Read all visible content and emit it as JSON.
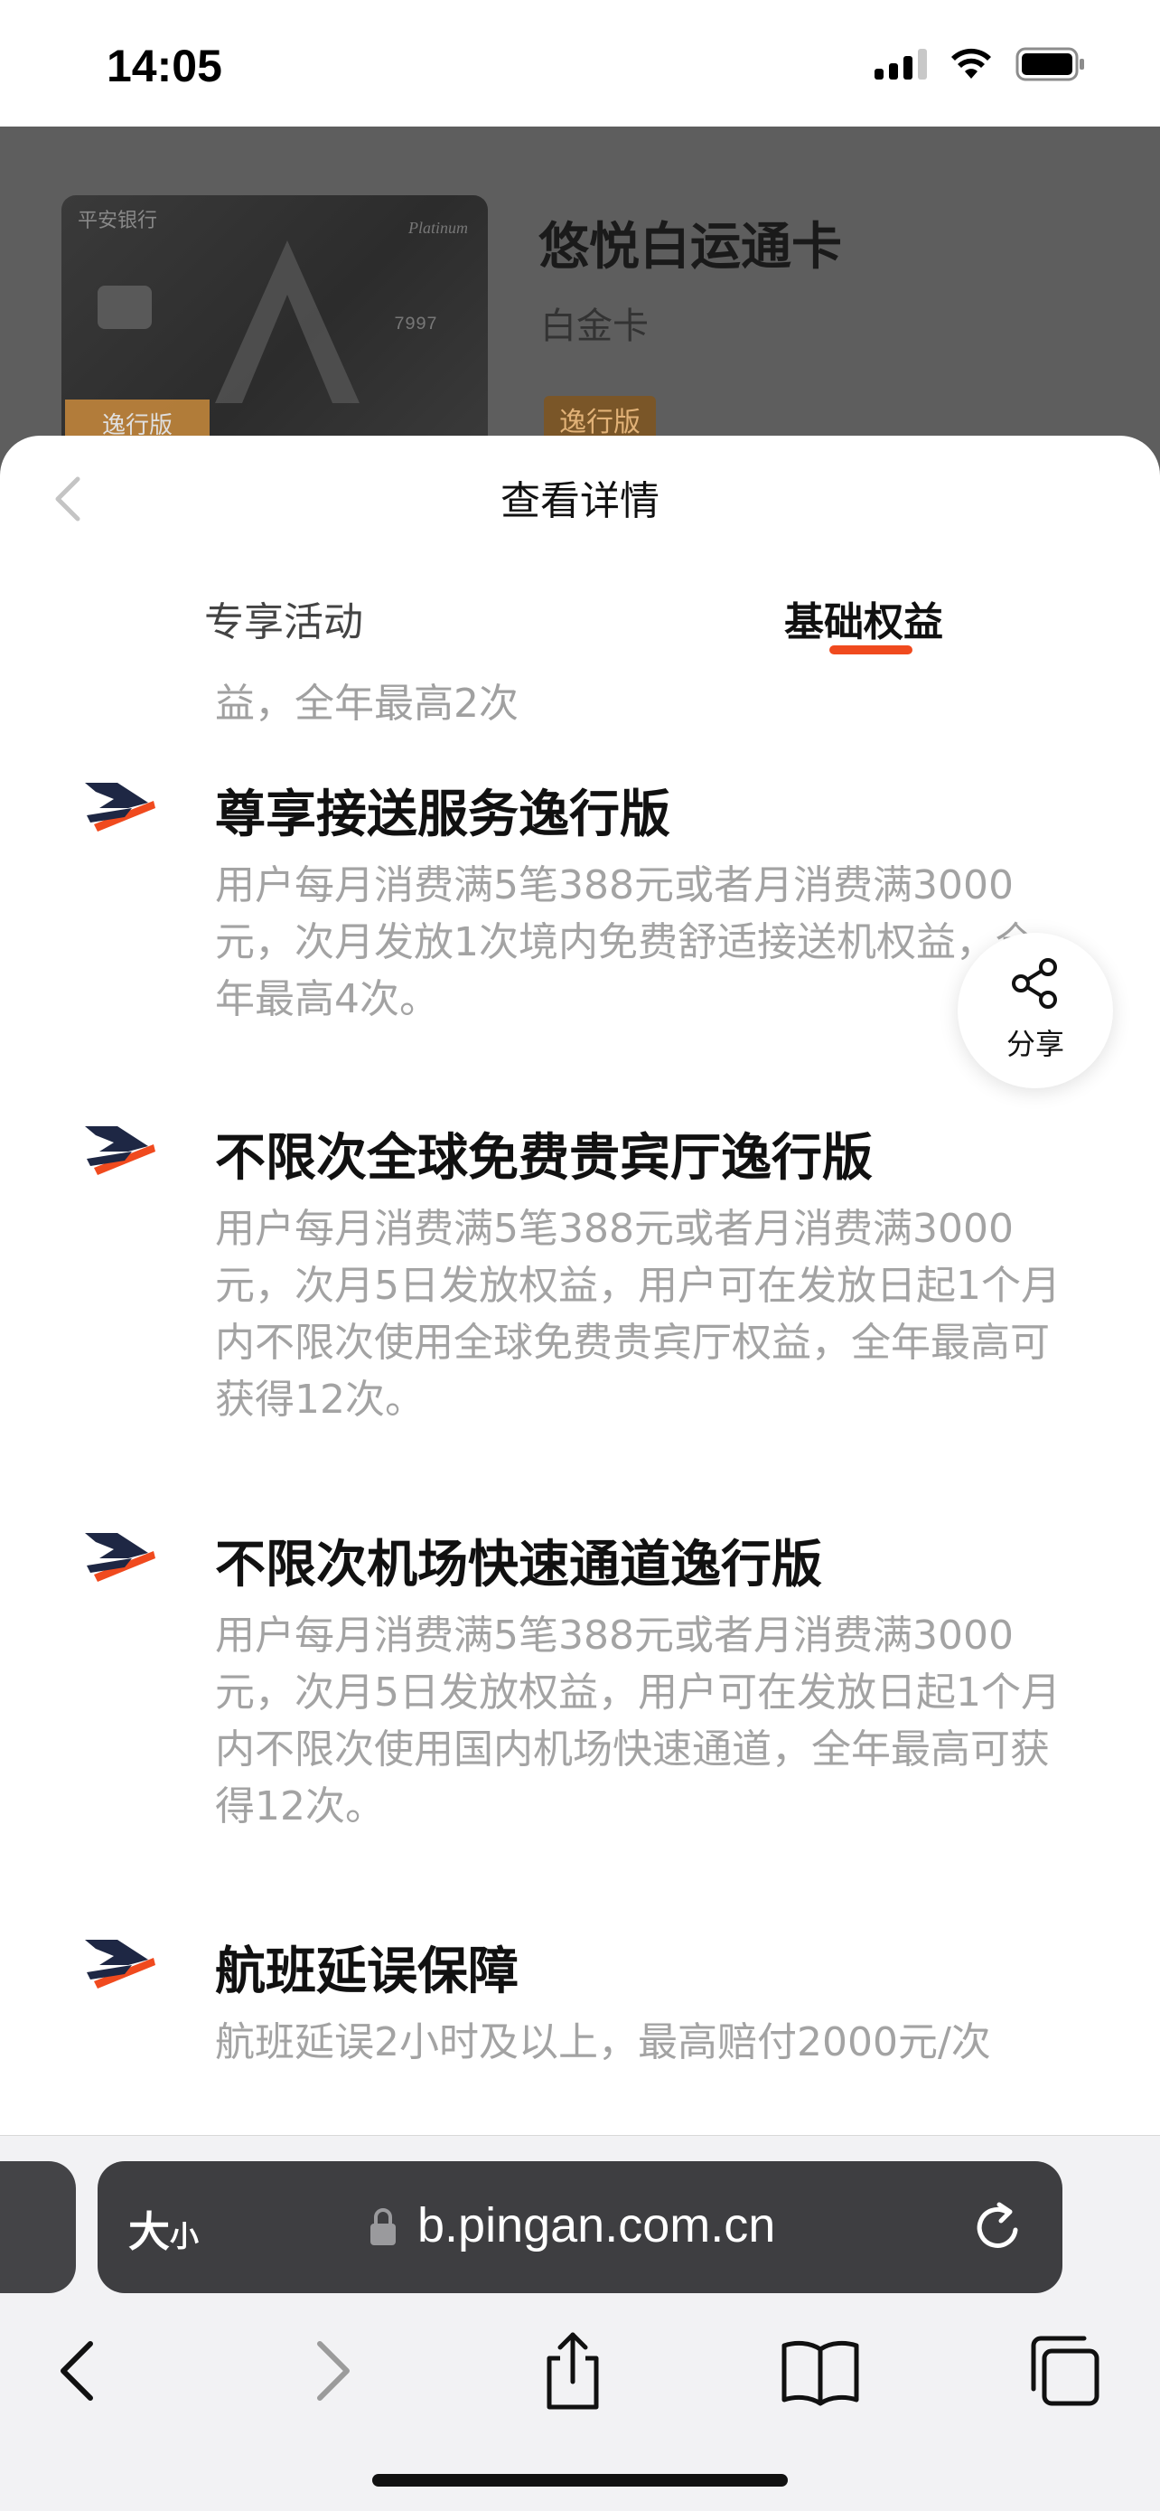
{
  "status_bar": {
    "time": "14:05",
    "icons": [
      "cellular-signal-icon",
      "wifi-icon",
      "battery-icon"
    ]
  },
  "background_page": {
    "card_image": {
      "bank_logo_text": "平安银行",
      "tier_text": "Platinum",
      "card_number_fragment": "7997",
      "badge_text": "逸行版"
    },
    "card_title": "悠悦白运通卡",
    "card_subtitle": "白金卡",
    "card_tag": "逸行版"
  },
  "sheet": {
    "title": "查看详情",
    "back_icon": "chevron-left-icon",
    "tabs": [
      {
        "label": "专享活动",
        "active": false
      },
      {
        "label": "基础权益",
        "active": true
      }
    ],
    "accent_color": "#f04a1e",
    "partial_text": "益，全年最高2次",
    "benefits": [
      {
        "icon": "airplane-icon",
        "title": "尊享接送服务逸行版",
        "description": "用户每月消费满5笔388元或者月消费满3000元，次月发放1次境内免费舒适接送机权益，全年最高4次。"
      },
      {
        "icon": "airplane-icon",
        "title": "不限次全球免费贵宾厅逸行版",
        "description": "用户每月消费满5笔388元或者月消费满3000元，次月5日发放权益，用户可在发放日起1个月内不限次使用全球免费贵宾厅权益，全年最高可获得12次。"
      },
      {
        "icon": "airplane-icon",
        "title": "不限次机场快速通道逸行版",
        "description": "用户每月消费满5笔388元或者月消费满3000元，次月5日发放权益，用户可在发放日起1个月内不限次使用国内机场快速通道，全年最高可获得12次。"
      },
      {
        "icon": "airplane-icon",
        "title": "航班延误保障",
        "description": "航班延误2小时及以上，最高赔付2000元/次"
      }
    ],
    "share": {
      "label": "分享",
      "icon": "share-icon"
    }
  },
  "browser": {
    "text_size_label_big": "大",
    "text_size_label_small": "小",
    "url": "b.pingan.com.cn",
    "toolbar": [
      "back-icon",
      "forward-icon",
      "share-icon",
      "bookmarks-icon",
      "tabs-icon"
    ]
  }
}
